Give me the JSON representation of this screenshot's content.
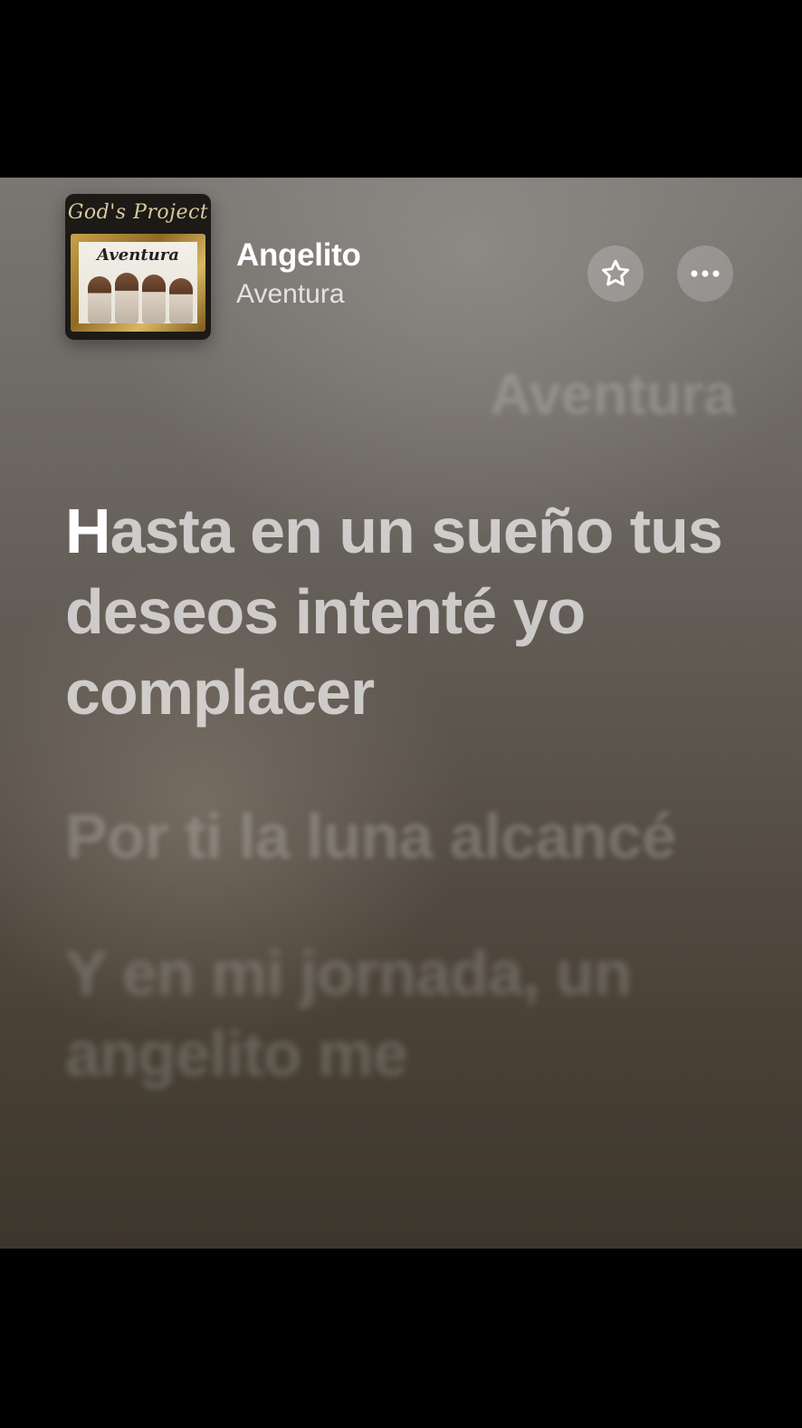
{
  "now_playing": {
    "song_title": "Angelito",
    "artist": "Aventura",
    "album_art": {
      "top_text": "God's Project",
      "logo_text": "Aventura"
    }
  },
  "actions": {
    "favorite_icon": "star-outline-icon",
    "more_icon": "ellipsis-icon"
  },
  "lyrics": {
    "credit_line": "Aventura",
    "active_line": {
      "sung_part": "H",
      "unsung_part": "asta en un sueño tus deseos intenté yo complacer"
    },
    "next_line": "Por ti la luna alcancé",
    "later_line": "Y en mi jornada, un angelito me"
  },
  "colors": {
    "background_top": "#7a7773",
    "background_bottom": "#3d362c",
    "text_primary": "#ffffff"
  }
}
